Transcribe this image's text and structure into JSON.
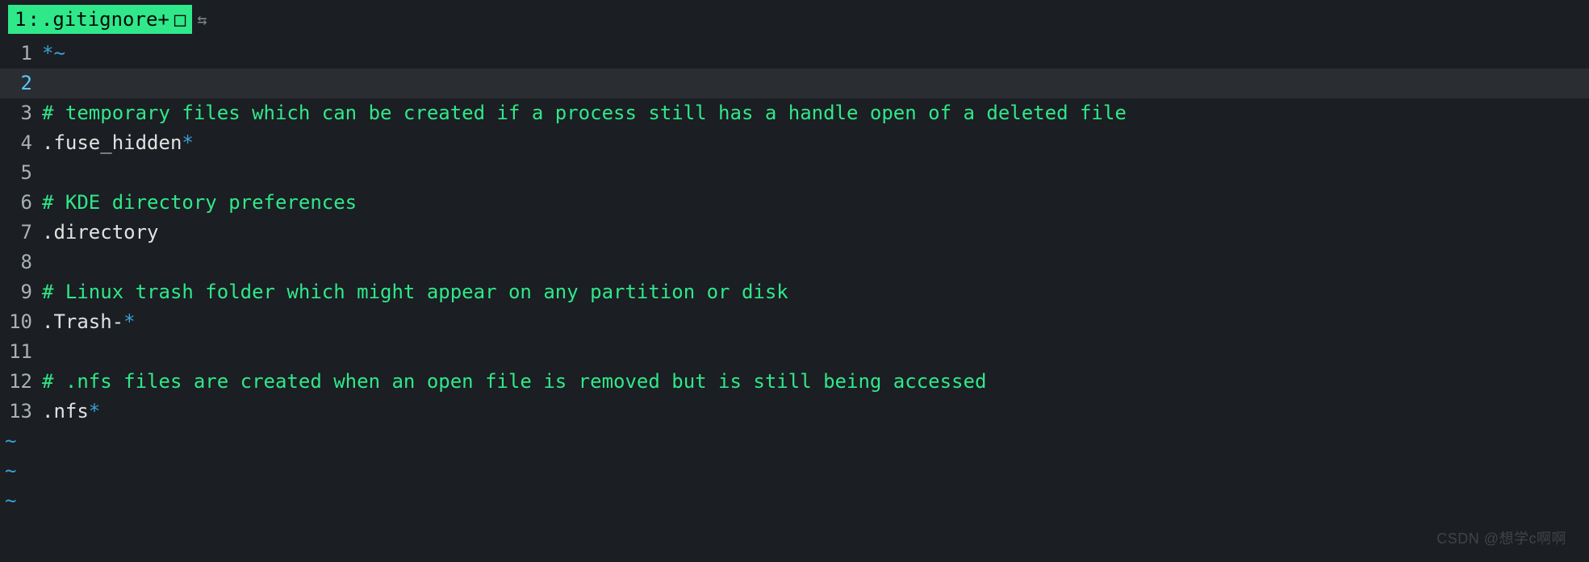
{
  "colors": {
    "background": "#1b1e22",
    "tab_bg": "#2fe88a",
    "tab_fg": "#0a0a0a",
    "syntax_green": "#2fe88a",
    "syntax_blue": "#3aa0d6",
    "syntax_white": "#dfe4e3",
    "gutter": "#aab0b3",
    "cursor_line_bg": "#2a2e33",
    "cursor_line_num": "#5cc8ff"
  },
  "tab": {
    "index": "1",
    "sep": ":",
    "filename": ".gitignore",
    "modified_marker": "+",
    "glyph": "□",
    "swap_icon": "⇆"
  },
  "cursor_line": 2,
  "lines": [
    {
      "n": "1",
      "tokens": [
        {
          "cls": "c-blue",
          "t": "*~"
        }
      ]
    },
    {
      "n": "2",
      "tokens": [
        {
          "cls": "c-white",
          "t": ""
        }
      ]
    },
    {
      "n": "3",
      "tokens": [
        {
          "cls": "c-green",
          "t": "# temporary files which can be created if a process still has a handle open of a deleted file"
        }
      ]
    },
    {
      "n": "4",
      "tokens": [
        {
          "cls": "c-white",
          "t": ".fuse_hidden"
        },
        {
          "cls": "c-blue",
          "t": "*"
        }
      ]
    },
    {
      "n": "5",
      "tokens": [
        {
          "cls": "c-white",
          "t": ""
        }
      ]
    },
    {
      "n": "6",
      "tokens": [
        {
          "cls": "c-green",
          "t": "# KDE directory preferences"
        }
      ]
    },
    {
      "n": "7",
      "tokens": [
        {
          "cls": "c-white",
          "t": ".directory"
        }
      ]
    },
    {
      "n": "8",
      "tokens": [
        {
          "cls": "c-white",
          "t": ""
        }
      ]
    },
    {
      "n": "9",
      "tokens": [
        {
          "cls": "c-green",
          "t": "# Linux trash folder which might appear on any partition or disk"
        }
      ]
    },
    {
      "n": "10",
      "tokens": [
        {
          "cls": "c-white",
          "t": ".Trash-"
        },
        {
          "cls": "c-blue",
          "t": "*"
        }
      ]
    },
    {
      "n": "11",
      "tokens": [
        {
          "cls": "c-white",
          "t": ""
        }
      ]
    },
    {
      "n": "12",
      "tokens": [
        {
          "cls": "c-green",
          "t": "# .nfs files are created when an open file is removed but is still being accessed"
        }
      ]
    },
    {
      "n": "13",
      "tokens": [
        {
          "cls": "c-white",
          "t": ".nfs"
        },
        {
          "cls": "c-blue",
          "t": "*"
        }
      ]
    }
  ],
  "tilde_rows": 3,
  "tilde_char": "~",
  "watermark": "CSDN @想学c啊啊"
}
